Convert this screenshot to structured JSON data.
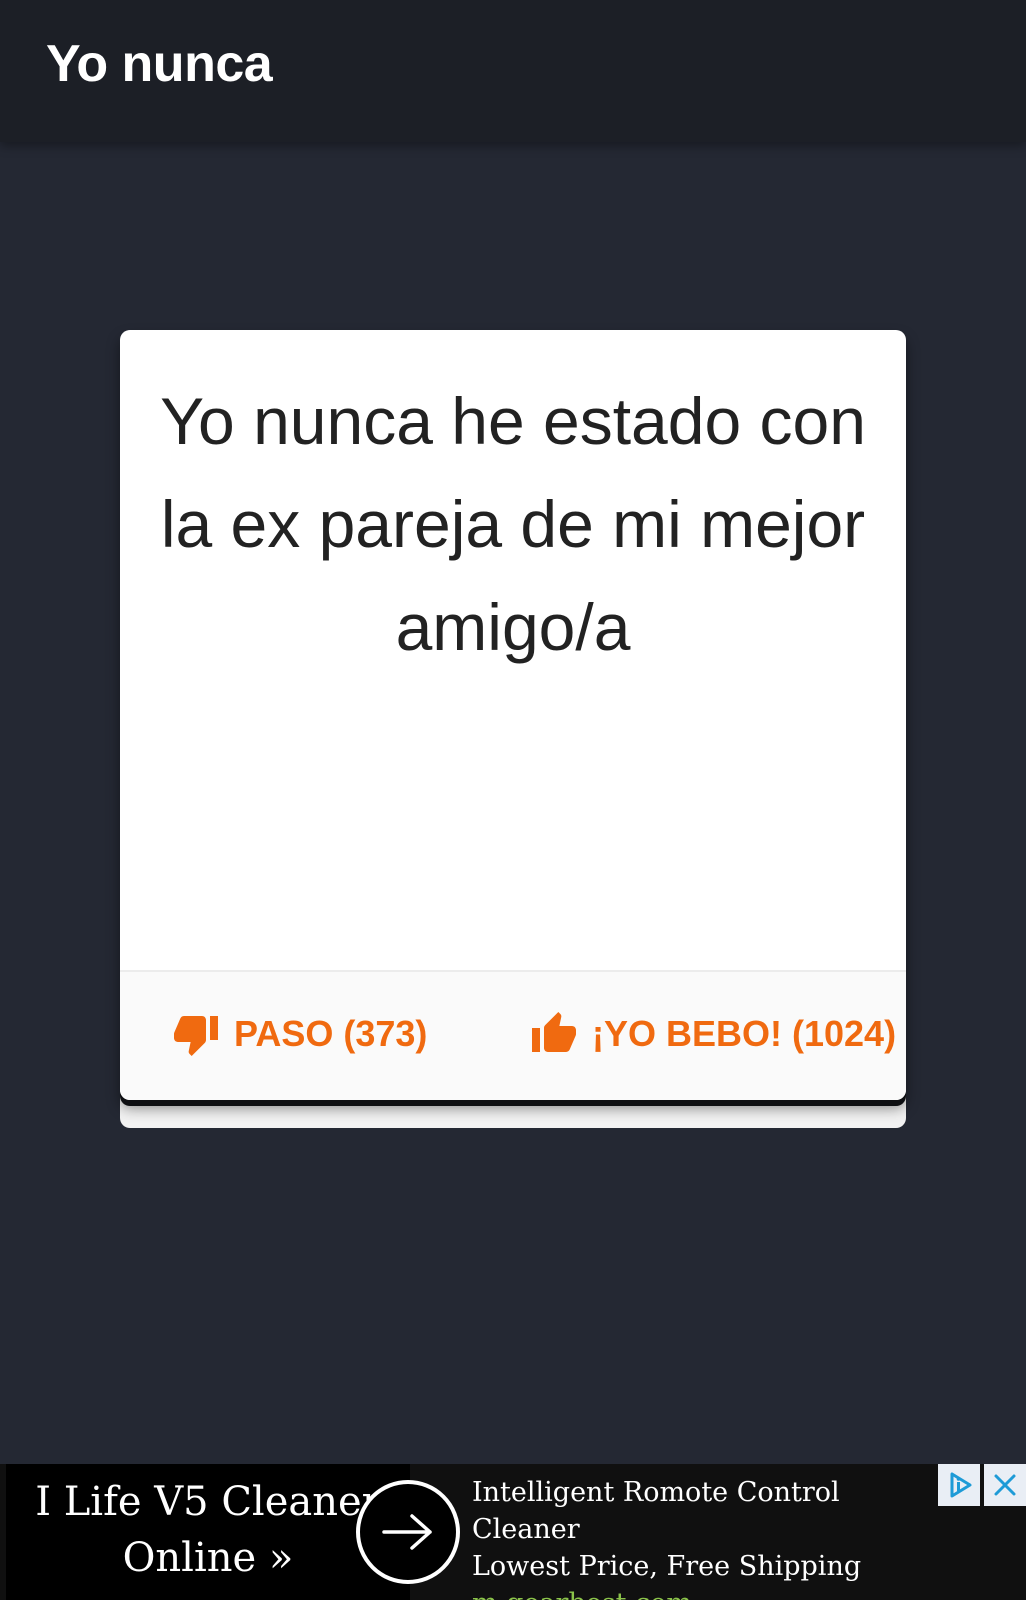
{
  "app": {
    "title": "Yo nunca"
  },
  "card": {
    "question": "Yo nunca he estado con la ex pareja de mi mejor amigo/a",
    "pass_label": "PASO (373)",
    "drink_label": "¡YO BEBO! (1024)"
  },
  "ad": {
    "left_line1": "I Life V5 Cleaner",
    "left_line2": "Online »",
    "headline": "Intelligent Romote Control Cleaner",
    "subline": "Lowest Price, Free Shipping",
    "url": "m.gearbest.com",
    "arrow_icon": "arrow-right-icon",
    "badge_icon": "adchoices-icon",
    "close_icon": "close-icon"
  },
  "colors": {
    "background": "#242833",
    "appbar": "#1c1f26",
    "accent": "#f06a10",
    "ad_url": "#8bc34a"
  }
}
